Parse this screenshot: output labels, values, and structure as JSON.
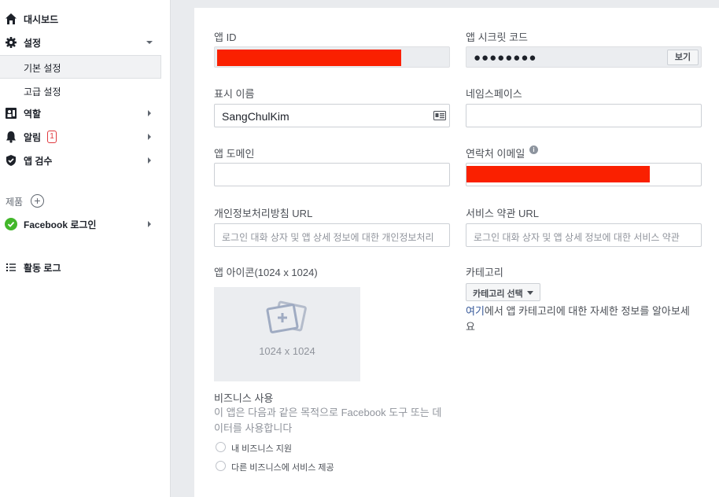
{
  "sidebar": {
    "dashboard": "대시보드",
    "settings": "설정",
    "settings_basic": "기본 설정",
    "settings_advanced": "고급 설정",
    "roles": "역할",
    "alerts": "알림",
    "alerts_count": "1",
    "app_review": "앱 검수",
    "products": "제품",
    "facebook_login": "Facebook 로그인",
    "activity_log": "활동 로그"
  },
  "form": {
    "app_id_label": "앱 ID",
    "app_secret_label": "앱 시크릿 코드",
    "app_secret_masked": "●●●●●●●●",
    "show_button": "보기",
    "display_name_label": "표시 이름",
    "display_name_value": "SangChulKim",
    "namespace_label": "네임스페이스",
    "namespace_value": "",
    "app_domain_label": "앱 도메인",
    "contact_email_label": "연락처 이메일",
    "privacy_url_label": "개인정보처리방침 URL",
    "privacy_url_placeholder": "로그인 대화 상자 및 앱 상세 정보에 대한 개인정보처리",
    "terms_url_label": "서비스 약관 URL",
    "terms_url_placeholder": "로그인 대화 상자 및 앱 상세 정보에 대한 서비스 약관",
    "app_icon_label": "앱 아이콘(1024 x 1024)",
    "app_icon_size": "1024 x 1024",
    "category_label": "카테고리",
    "category_button": "카테고리 선택",
    "category_help_link": "여기",
    "category_help_text": "에서 앱 카테고리에 대한 자세한 정보를 알아보세요",
    "business_use_label": "비즈니스 사용",
    "business_use_desc": "이 앱은 다음과 같은 목적으로 Facebook 도구 또는 데이터를 사용합니다",
    "business_option_1": "내 비즈니스 지원",
    "business_option_2": "다른 비즈니스에 서비스 제공"
  },
  "colors": {
    "redaction": "#fa2000",
    "link": "#365899",
    "success": "#42b72a",
    "alert": "#e0393e"
  }
}
